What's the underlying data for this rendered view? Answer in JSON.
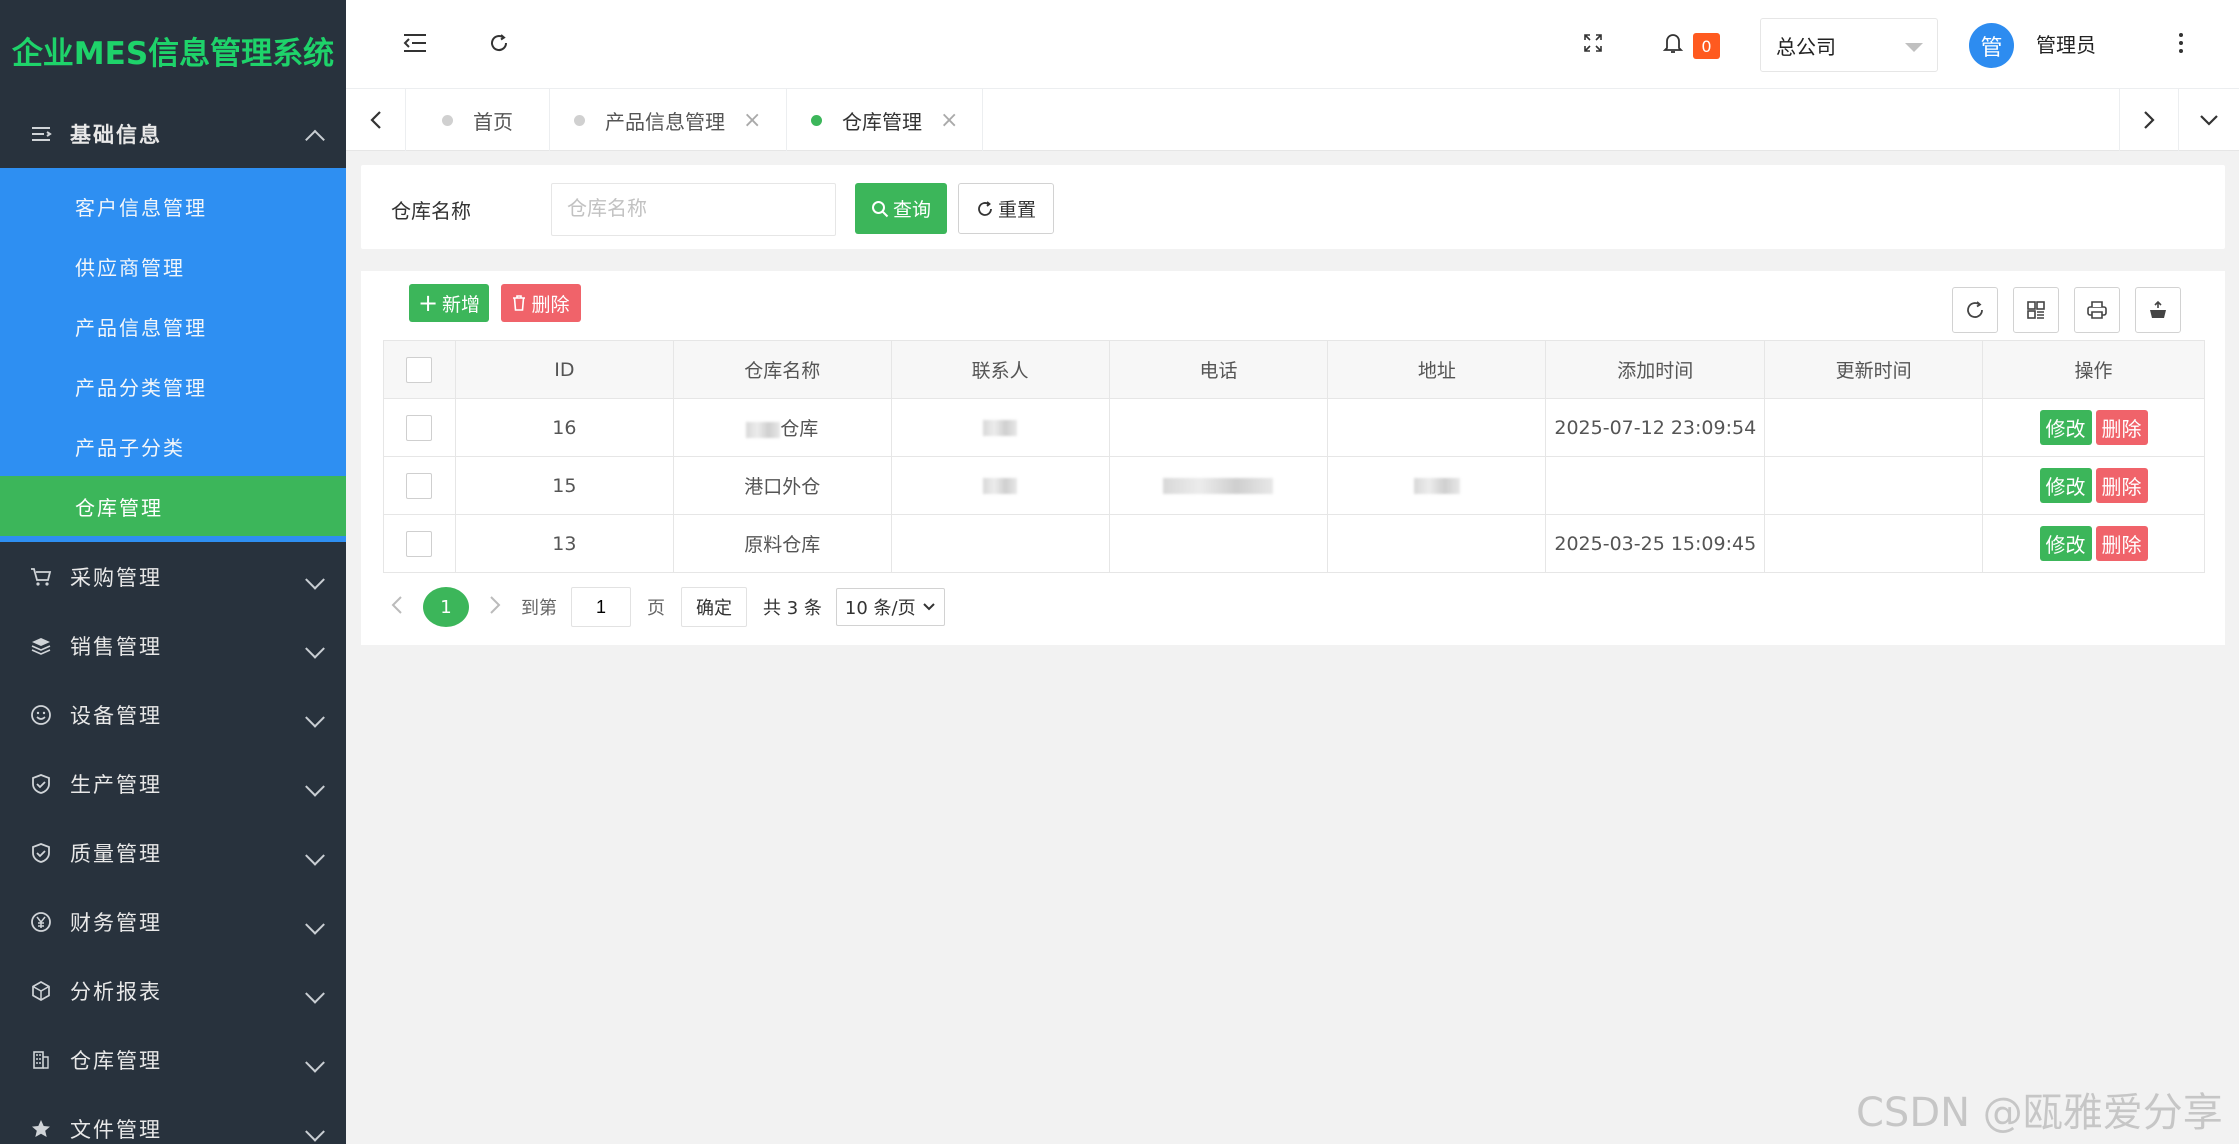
{
  "app": {
    "title": "企业MES信息管理系统"
  },
  "sidebar": {
    "open_group": {
      "label": "基础信息",
      "icon": "list-icon"
    },
    "sub_items": [
      {
        "label": "客户信息管理",
        "active": false
      },
      {
        "label": "供应商管理",
        "active": false
      },
      {
        "label": "产品信息管理",
        "active": false
      },
      {
        "label": "产品分类管理",
        "active": false
      },
      {
        "label": "产品子分类",
        "active": false
      },
      {
        "label": "仓库管理",
        "active": true
      }
    ],
    "groups": [
      {
        "label": "采购管理",
        "icon": "cart-icon"
      },
      {
        "label": "销售管理",
        "icon": "layers-icon"
      },
      {
        "label": "设备管理",
        "icon": "smile-icon"
      },
      {
        "label": "生产管理",
        "icon": "shield-icon"
      },
      {
        "label": "质量管理",
        "icon": "shield-icon"
      },
      {
        "label": "财务管理",
        "icon": "yen-icon"
      },
      {
        "label": "分析报表",
        "icon": "cube-icon"
      },
      {
        "label": "仓库管理",
        "icon": "building-icon"
      },
      {
        "label": "文件管理",
        "icon": "star-icon"
      }
    ]
  },
  "header": {
    "notification_count": "0",
    "company": "总公司",
    "avatar_text": "管",
    "username": "管理员"
  },
  "tabs": [
    {
      "label": "首页",
      "closable": false,
      "active": false
    },
    {
      "label": "产品信息管理",
      "closable": true,
      "active": false
    },
    {
      "label": "仓库管理",
      "closable": true,
      "active": true
    }
  ],
  "search": {
    "label": "仓库名称",
    "placeholder": "仓库名称",
    "value": "",
    "query_label": "查询",
    "reset_label": "重置"
  },
  "toolbar": {
    "add_label": "新增",
    "delete_label": "删除"
  },
  "table": {
    "columns": [
      "ID",
      "仓库名称",
      "联系人",
      "电话",
      "地址",
      "添加时间",
      "更新时间",
      "操作"
    ],
    "rows": [
      {
        "id": "16",
        "name": "仓库",
        "add_time": "2025-07-12 23:09:54",
        "update_time": ""
      },
      {
        "id": "15",
        "name": "港口外仓",
        "add_time": "",
        "update_time": ""
      },
      {
        "id": "13",
        "name": "原料仓库",
        "add_time": "2025-03-25 15:09:45",
        "update_time": ""
      }
    ],
    "edit_label": "修改",
    "delete_label": "删除"
  },
  "pagination": {
    "current": "1",
    "goto_label": "到第",
    "page_value": "1",
    "page_unit": "页",
    "confirm_label": "确定",
    "total_label": "共 3 条",
    "page_size": "10 条/页"
  },
  "watermark": "CSDN @瓯雅爱分享",
  "colors": {
    "sidebar_bg": "#28323d",
    "submenu_bg": "#2e8ff2",
    "accent_green": "#3cb65a",
    "danger_red": "#f0636a",
    "logo_green": "#1ed36a"
  }
}
